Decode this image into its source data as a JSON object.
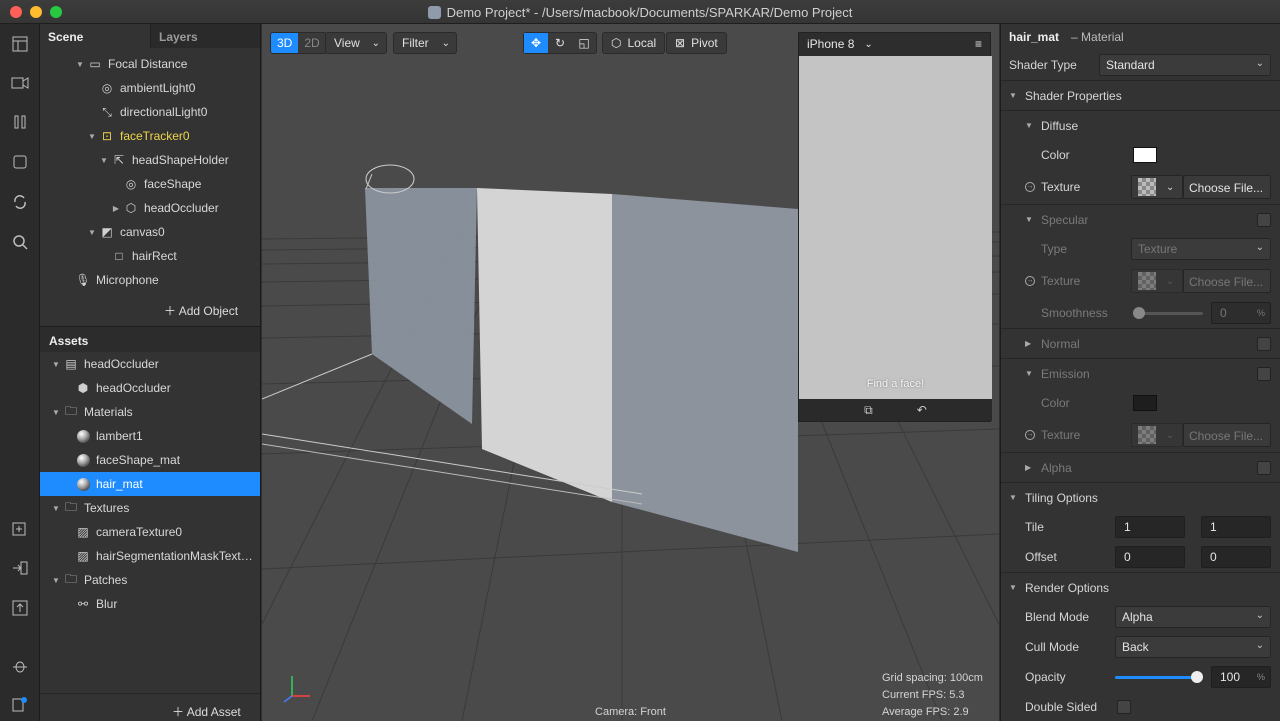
{
  "window": {
    "title": "Demo Project* - /Users/macbook/Documents/SPARKAR/Demo Project"
  },
  "left": {
    "tabs": [
      "Scene",
      "Layers"
    ],
    "scene_items": [
      {
        "label": "Focal Distance"
      },
      {
        "label": "ambientLight0"
      },
      {
        "label": "directionalLight0"
      },
      {
        "label": "faceTracker0"
      },
      {
        "label": "headShapeHolder"
      },
      {
        "label": "faceShape"
      },
      {
        "label": "headOccluder"
      },
      {
        "label": "canvas0"
      },
      {
        "label": "hairRect"
      },
      {
        "label": "Microphone"
      }
    ],
    "add_object": "Add Object",
    "assets_title": "Assets",
    "asset_items": [
      {
        "label": "headOccluder"
      },
      {
        "label": "headOccluder"
      },
      {
        "label": "Materials"
      },
      {
        "label": "lambert1"
      },
      {
        "label": "faceShape_mat"
      },
      {
        "label": "hair_mat"
      },
      {
        "label": "Textures"
      },
      {
        "label": "cameraTexture0"
      },
      {
        "label": "hairSegmentationMaskText…"
      },
      {
        "label": "Patches"
      },
      {
        "label": "Blur"
      }
    ],
    "add_asset": "Add Asset"
  },
  "viewport": {
    "mode_3d": "3D",
    "mode_2d": "2D",
    "view_label": "View",
    "filter_label": "Filter",
    "local_label": "Local",
    "pivot_label": "Pivot",
    "camera": "Camera: Front",
    "grid_spacing": "Grid spacing: 100cm",
    "current_fps": "Current FPS:  5.3",
    "average_fps": "Average FPS:  2.9",
    "device": {
      "name": "iPhone 8",
      "prompt": "Find a face!"
    }
  },
  "inspector": {
    "name": "hair_mat",
    "kind": "– Material",
    "shader_type_label": "Shader Type",
    "shader_type_value": "Standard",
    "shader_properties": "Shader Properties",
    "diffuse": "Diffuse",
    "color_label": "Color",
    "texture_label": "Texture",
    "choose_file": "Choose File...",
    "specular": "Specular",
    "type_label": "Type",
    "type_value": "Texture",
    "smoothness_label": "Smoothness",
    "smoothness_value": "0",
    "percent": "%",
    "normal": "Normal",
    "emission": "Emission",
    "alpha": "Alpha",
    "tiling_options": "Tiling Options",
    "tile_label": "Tile",
    "tile_x": "1",
    "tile_y": "1",
    "offset_label": "Offset",
    "offset_x": "0",
    "offset_y": "0",
    "render_options": "Render Options",
    "blend_mode_label": "Blend Mode",
    "blend_mode_value": "Alpha",
    "cull_mode_label": "Cull Mode",
    "cull_mode_value": "Back",
    "opacity_label": "Opacity",
    "opacity_value": "100",
    "opacity_fraction": 1.0,
    "double_sided_label": "Double Sided",
    "diffuse_color": "#ffffff",
    "emission_color": "#1e1e1e"
  },
  "colors": {
    "accent": "#1e8cff",
    "highlight": "#f0d64a"
  }
}
